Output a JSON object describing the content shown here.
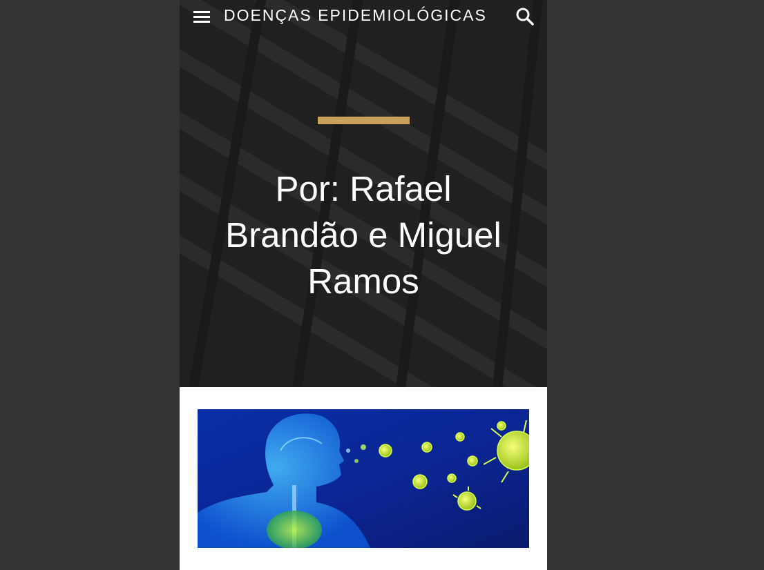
{
  "header": {
    "site_title": "DOENÇAS EPIDEMIOLÓGICAS",
    "menu_icon": "hamburger-menu-icon",
    "search_icon": "search-icon"
  },
  "hero": {
    "post_title": "Por: Rafael Brandão e Miguel Ramos",
    "accent_color": "#c9a15a"
  },
  "post": {
    "image_description_icon": "respiratory-virus-illustration"
  },
  "colors": {
    "outer_background": "#333333",
    "hero_background": "#2a2a2a",
    "content_background": "#ffffff"
  }
}
